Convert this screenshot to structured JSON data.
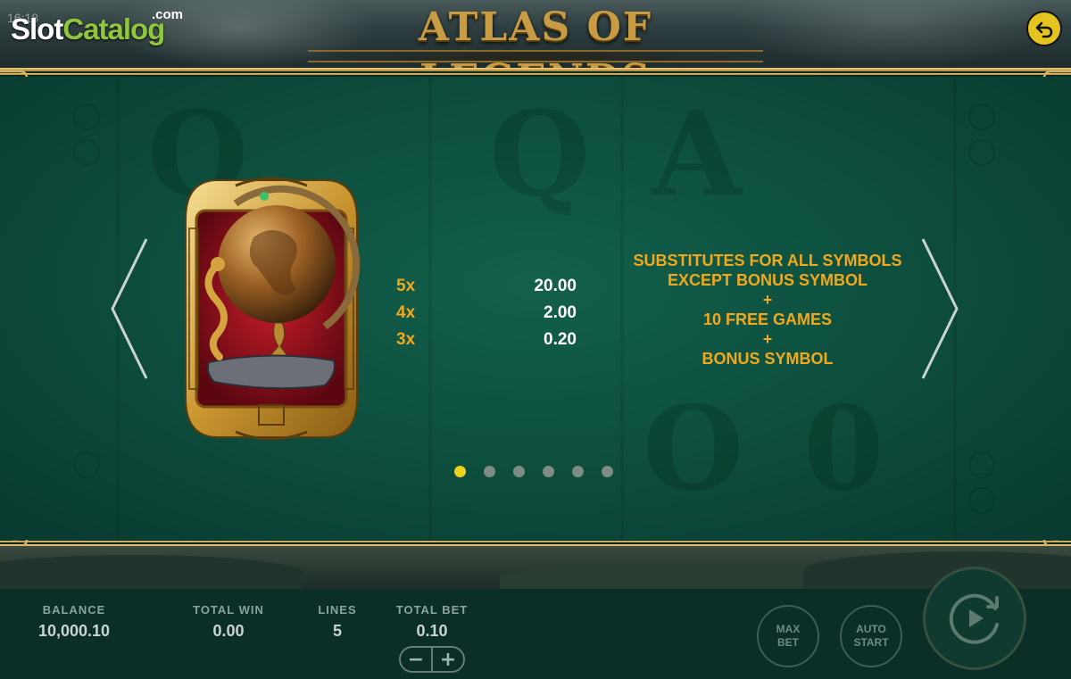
{
  "header": {
    "clock": "16:18",
    "logo_part1": "Slot",
    "logo_part2": "Catalog",
    "logo_dotcom": ".com",
    "game_title": "ATLAS OF LEGENDS"
  },
  "paytable": {
    "payouts": [
      {
        "count": "5x",
        "value": "20.00"
      },
      {
        "count": "4x",
        "value": "2.00"
      },
      {
        "count": "3x",
        "value": "0.20"
      }
    ],
    "description": [
      "SUBSTITUTES FOR ALL SYMBOLS",
      "EXCEPT BONUS SYMBOL",
      "+",
      "10 FREE GAMES",
      "+",
      "BONUS SYMBOL"
    ],
    "page_count": 6,
    "active_page": 1
  },
  "footer": {
    "balance_label": "BALANCE",
    "balance_value": "10,000.10",
    "total_win_label": "TOTAL WIN",
    "total_win_value": "0.00",
    "lines_label": "LINES",
    "lines_value": "5",
    "total_bet_label": "TOTAL BET",
    "total_bet_value": "0.10",
    "minus_label": "−",
    "plus_label": "+",
    "max_bet_line1": "MAX",
    "max_bet_line2": "BET",
    "auto_start_line1": "AUTO",
    "auto_start_line2": "START"
  },
  "colors": {
    "gold_text": "#f2a81d",
    "active_dot": "#ead21f",
    "panel_green": "#0d4c3c",
    "back_button": "#e6c41f"
  },
  "icons": {
    "back": "back-arrow-icon",
    "prev": "chevron-left-icon",
    "next": "chevron-right-icon",
    "spin": "spin-play-icon",
    "symbol": "globe-wild-symbol"
  }
}
